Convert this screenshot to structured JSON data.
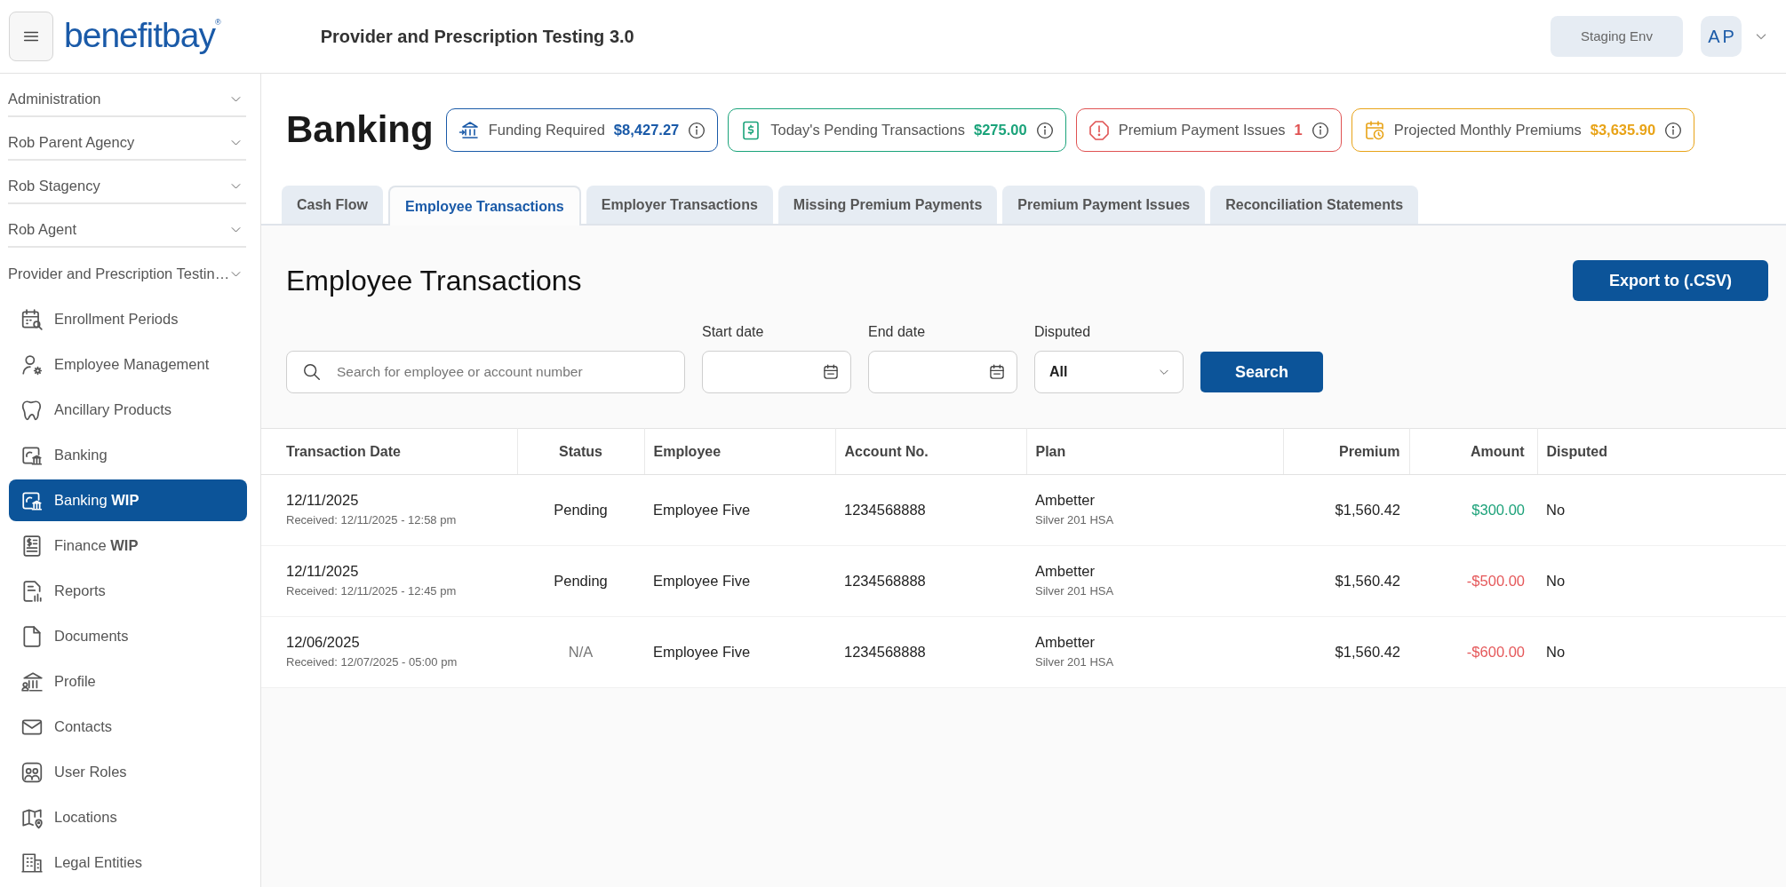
{
  "header": {
    "logo": "benefitbay$^{®}$",
    "title": "Provider and Prescription Testing 3.0",
    "env_button": "Staging Env",
    "avatar": "AP"
  },
  "sidebar": {
    "groups": [
      {
        "label": "Administration",
        "expanded": false
      },
      {
        "label": "Rob Parent Agency",
        "expanded": false
      },
      {
        "label": "Rob Stagency",
        "expanded": false
      },
      {
        "label": "Rob Agent",
        "expanded": false
      },
      {
        "label": "Provider and Prescription Testin…",
        "expanded": false
      }
    ],
    "items": [
      {
        "label": "Enrollment Periods",
        "selected": false
      },
      {
        "label": "Employee Management",
        "selected": false
      },
      {
        "label": "Ancillary Products",
        "selected": false
      },
      {
        "label": "Banking",
        "selected": false
      },
      {
        "label": "Banking **WIP**",
        "selected": true
      },
      {
        "label": "Finance **WIP**",
        "selected": false
      },
      {
        "label": "Reports",
        "selected": false
      },
      {
        "label": "Documents",
        "selected": false
      },
      {
        "label": "Profile",
        "selected": false
      },
      {
        "label": "Contacts",
        "selected": false
      },
      {
        "label": "User Roles",
        "selected": false
      },
      {
        "label": "Locations",
        "selected": false
      },
      {
        "label": "Legal Entities",
        "selected": false
      }
    ]
  },
  "page": {
    "title": "Banking",
    "stats": [
      {
        "label": "Funding Required",
        "value": "$8,427.27",
        "color": "#1a5aa8"
      },
      {
        "label": "Today's Pending Transactions",
        "value": "$275.00",
        "color": "#1aa37a"
      },
      {
        "label": "Premium Payment Issues",
        "value": "1",
        "color": "#e05252"
      },
      {
        "label": "Projected Monthly Premiums",
        "value": "$3,635.90",
        "color": "#e8a317"
      }
    ]
  },
  "tabs": [
    {
      "label": "Cash Flow",
      "selected": false
    },
    {
      "label": "Employee Transactions",
      "selected": true
    },
    {
      "label": "Employer Transactions",
      "selected": false
    },
    {
      "label": "Missing Premium Payments",
      "selected": false
    },
    {
      "label": "Premium Payment Issues",
      "selected": false
    },
    {
      "label": "Reconciliation Statements",
      "selected": false
    }
  ],
  "section": {
    "title": "Employee Transactions",
    "export_button": "Export to (.CSV)",
    "filters": {
      "search": {
        "placeholder": "Search for employee or account number"
      },
      "start_date": {
        "label": "Start date"
      },
      "end_date": {
        "label": "End date"
      },
      "disputed": {
        "label": "Disputed",
        "value": "All"
      },
      "search_button": "Search"
    }
  },
  "table": {
    "columns": [
      "Transaction Date",
      "Status",
      "Employee",
      "Account No.",
      "Plan",
      "Premium",
      "Amount",
      "Disputed"
    ],
    "rows": [
      {
        "date": "12/11/2025",
        "received": "Received: 12/11/2025 - 12:58 pm",
        "status": {
          "text": "Pending",
          "muted": false
        },
        "employee": "Employee Five",
        "account": "1234568888",
        "plan": "Ambetter",
        "plan_detail": "Silver 201 HSA",
        "premium": "$1,560.42",
        "amount": {
          "text": "$300.00",
          "color": "#1da27a"
        },
        "disputed": "No"
      },
      {
        "date": "12/11/2025",
        "received": "Received: 12/11/2025 - 12:45 pm",
        "status": {
          "text": "Pending",
          "muted": false
        },
        "employee": "Employee Five",
        "account": "1234568888",
        "plan": "Ambetter",
        "plan_detail": "Silver 201 HSA",
        "premium": "$1,560.42",
        "amount": {
          "text": "-$500.00",
          "color": "#e5585a"
        },
        "disputed": "No"
      },
      {
        "date": "12/06/2025",
        "received": "Received: 12/07/2025 - 05:00 pm",
        "status": {
          "text": "N/A",
          "muted": true
        },
        "employee": "Employee Five",
        "account": "1234568888",
        "plan": "Ambetter",
        "plan_detail": "Silver 201 HSA",
        "premium": "$1,560.42",
        "amount": {
          "text": "-$600.00",
          "color": "#e5585a"
        },
        "disputed": "No"
      }
    ]
  }
}
